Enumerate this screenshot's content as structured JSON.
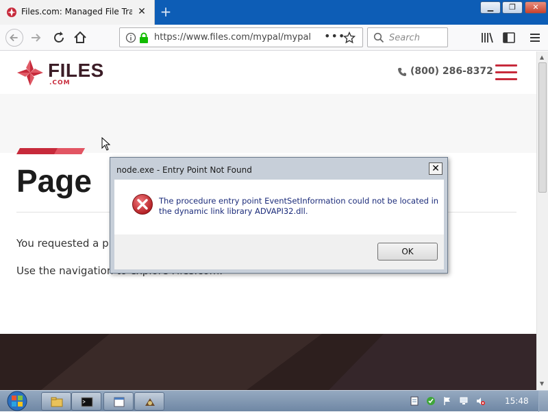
{
  "browser": {
    "tab_title": "Files.com: Managed File Transfer",
    "url": "https://www.files.com/mypal/mypal",
    "search_placeholder": "Search",
    "url_dots": "•••"
  },
  "site": {
    "brand": "FILES",
    "brand_suffix": ".COM",
    "phone": "(800) 286-8372",
    "heading": "Page",
    "para1": "You requested a p",
    "para2": "Use the navigation to explore Files.com."
  },
  "dialog": {
    "title": "node.exe - Entry Point Not Found",
    "close_glyph": "✕",
    "message_line1": "The procedure entry point EventSetInformation could not be located in",
    "message_line2": "the dynamic link library ADVAPI32.dll.",
    "ok_label": "OK"
  },
  "taskbar": {
    "clock": "15:48",
    "items": [
      "explorer-icon",
      "cmd-icon",
      "window-icon",
      "app-icon"
    ]
  },
  "colors": {
    "brand_red": "#c72a3b",
    "brand_dark": "#3c1d27",
    "tabstrip_blue": "#0d5db6",
    "error_red": "#c62828"
  }
}
